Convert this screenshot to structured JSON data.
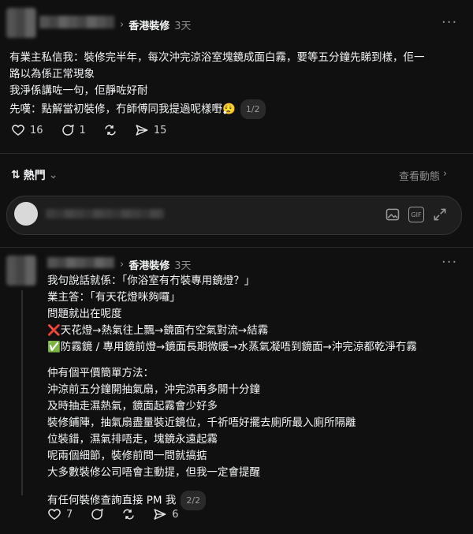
{
  "post1": {
    "group": "香港裝修",
    "time": "3天",
    "lines": [
      "有業主私信我：裝修完半年，每次沖完涼浴室塊鏡成面白霧，要等五分鐘先睇到樣，佢一",
      "路以為係正常現象",
      "我淨係講咗一句，佢靜咗好耐",
      "先嘆：點解當初裝修，冇師傅同我提過呢樣嘢😮‍💨"
    ],
    "page_indicator": "1/2",
    "likes": "16",
    "comments": "1",
    "shares": "15"
  },
  "sort": {
    "label": "熱門",
    "view_activity": "查看動態"
  },
  "post2": {
    "group": "香港裝修",
    "time": "3天",
    "lines_a": [
      "我句說話就係：「你浴室有冇裝專用鏡燈？」",
      "業主答：「有天花燈咪夠囉」",
      "問題就出在呢度",
      "❌天花燈→熱氣往上飄→鏡面冇空氣對流→結霧",
      "✅防霧鏡 / 專用鏡前燈→鏡面長期微暖→水蒸氣凝唔到鏡面→沖完涼都乾淨冇霧"
    ],
    "lines_b": [
      "仲有個平價簡單方法：",
      "沖涼前五分鐘開抽氣扇，沖完涼再多開十分鐘",
      "及時抽走濕熱氣，鏡面起霧會少好多",
      "裝修鋪陣，抽氣扇盡量裝近鏡位，千祈唔好擺去廁所最入廁所隔離",
      "位裝錯，濕氣排唔走，塊鏡永遠起霧",
      "呢兩個細節，裝修前問一問就搞掂",
      "大多數裝修公司唔會主動提，但我一定會提醒"
    ],
    "last_line": "有任何裝修查詢直接 PM 我",
    "page_indicator": "2/2",
    "likes": "7",
    "shares": "6"
  },
  "icons": {
    "more": "more-icon",
    "chevron": "chevron-right-icon",
    "like": "heart-icon",
    "comment": "comment-icon",
    "repost": "repost-icon",
    "share": "send-icon",
    "sort": "sort-icon",
    "gallery": "image-icon",
    "gif": "gif-icon",
    "expand": "expand-icon"
  }
}
